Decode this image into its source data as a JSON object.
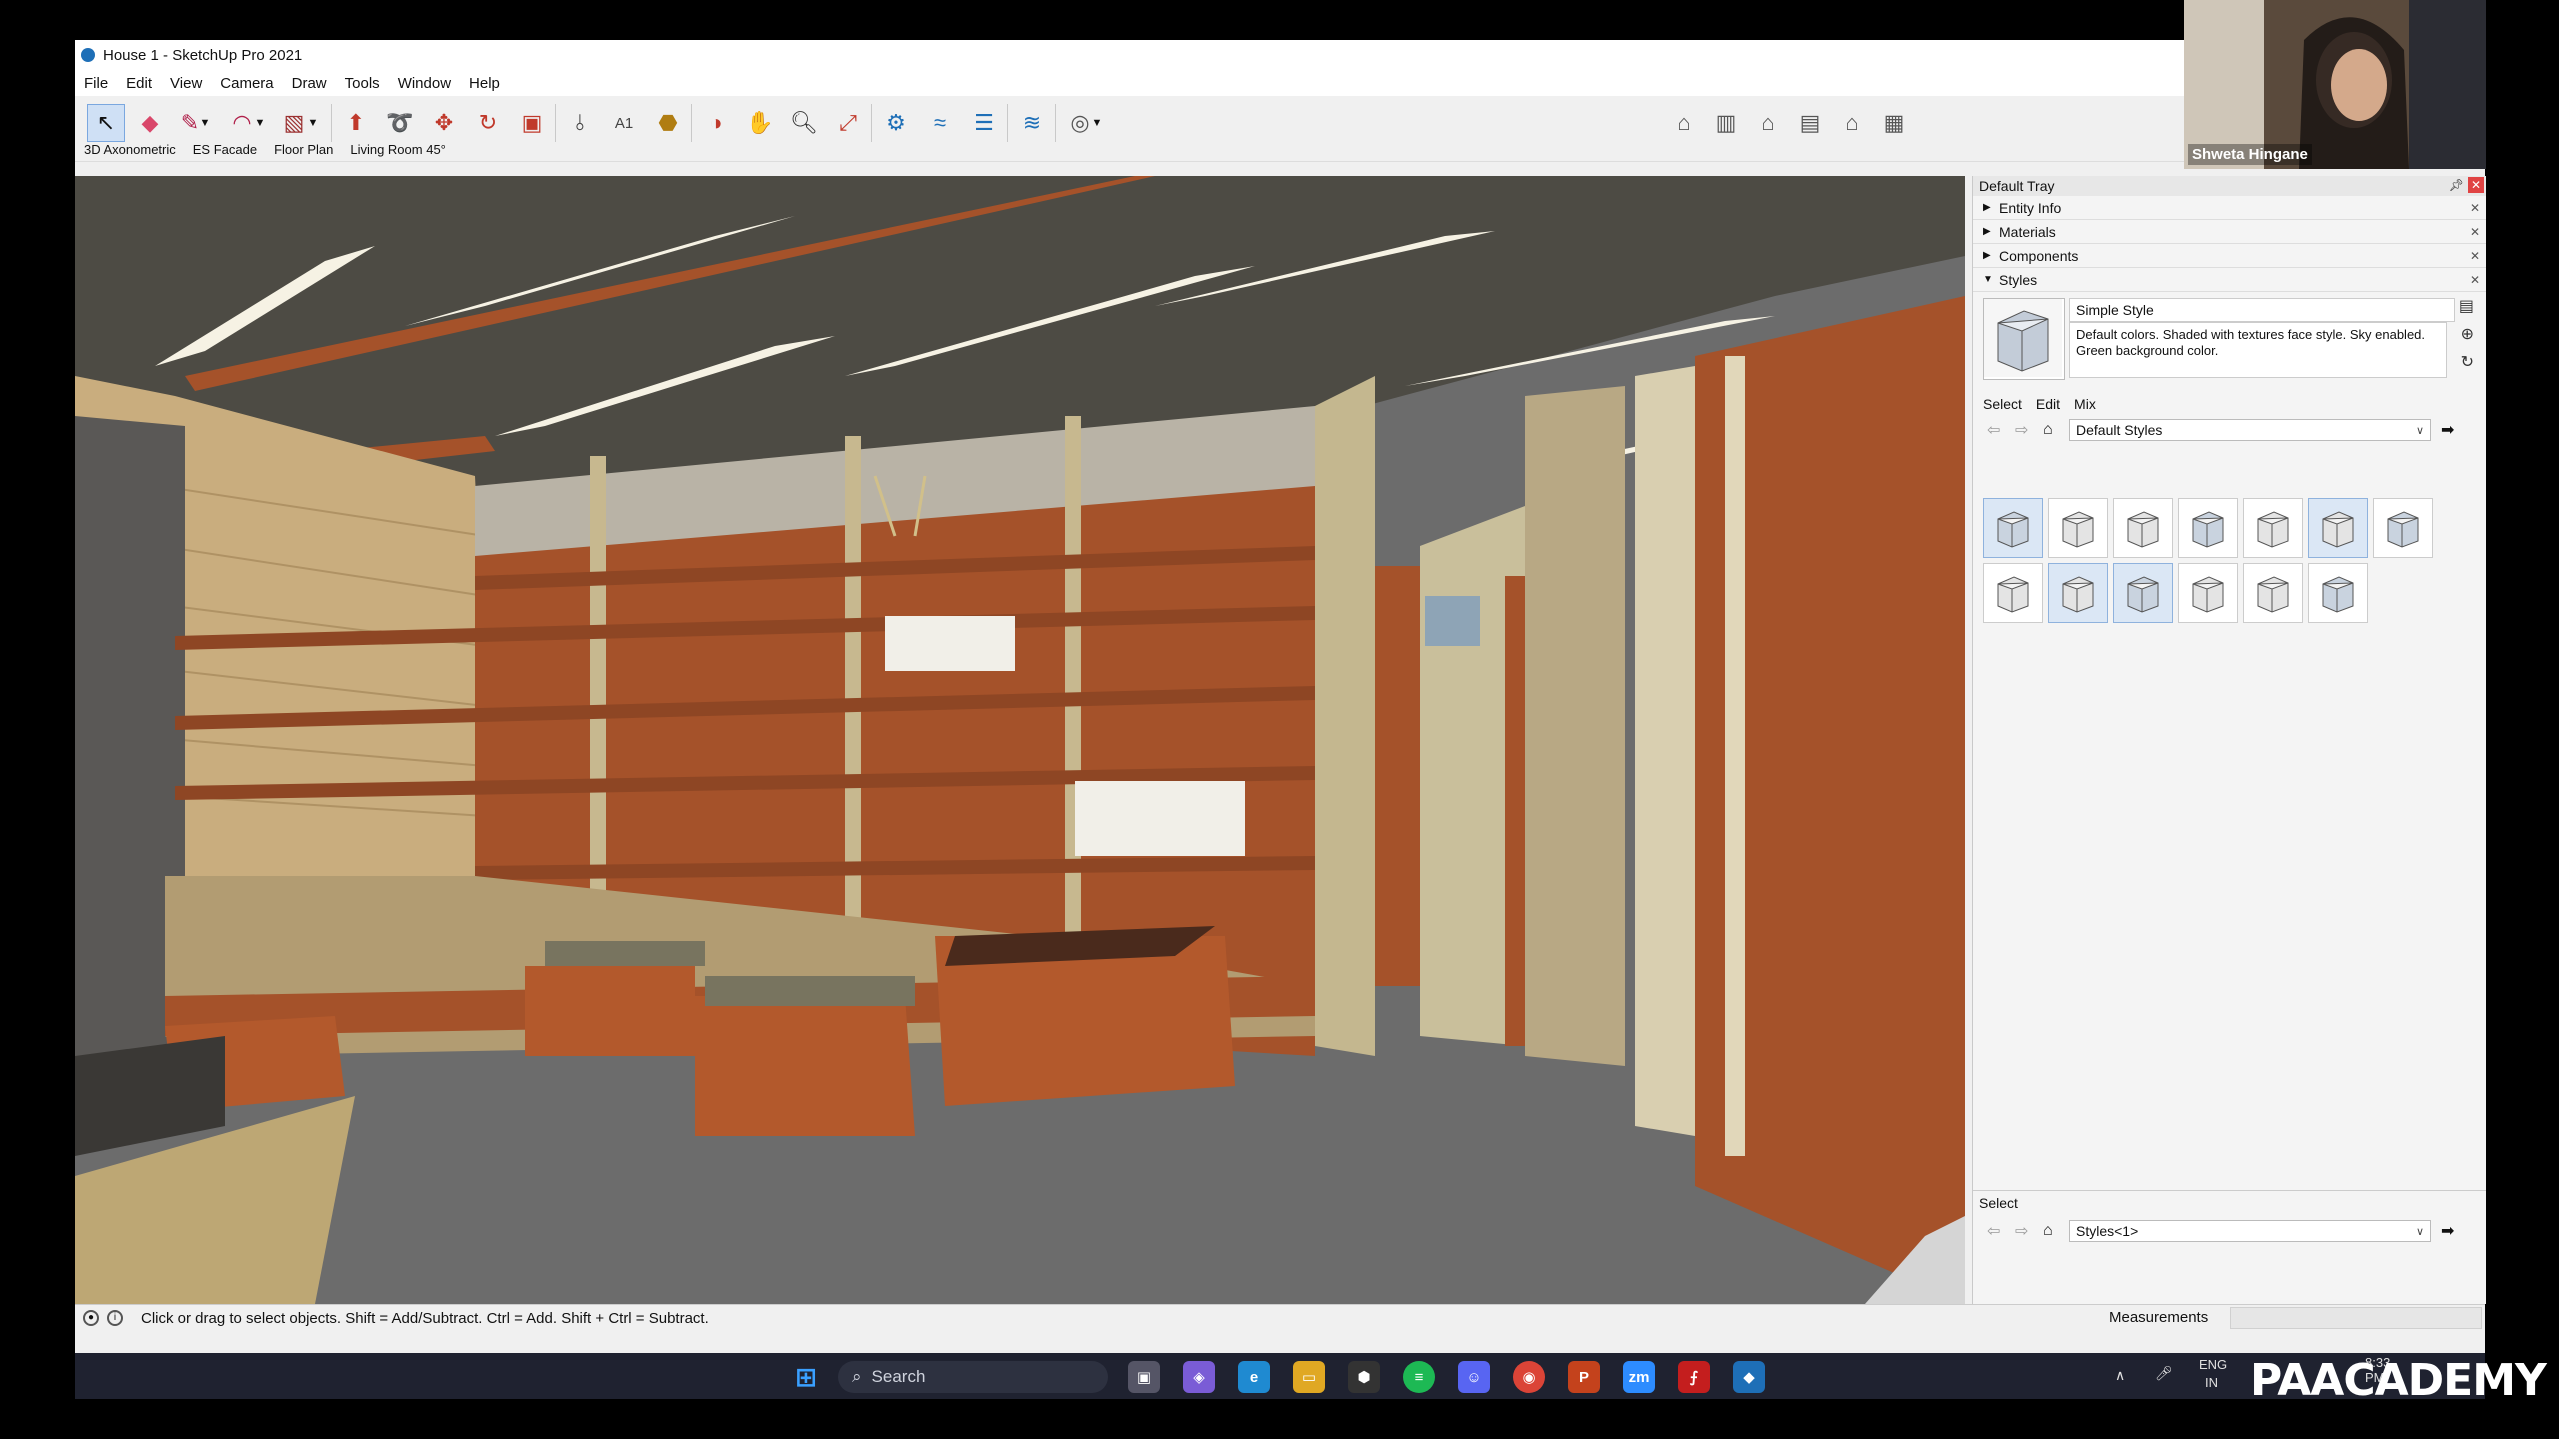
{
  "app": {
    "title": "House 1 - SketchUp Pro 2021",
    "menu": [
      "File",
      "Edit",
      "View",
      "Camera",
      "Draw",
      "Tools",
      "Window",
      "Help"
    ]
  },
  "toolbar": {
    "left_tools": [
      "select-icon",
      "eraser-icon",
      "pencil-icon",
      "arc-icon",
      "rectangle-icon",
      "push-pull-icon",
      "follow-me-icon",
      "move-icon",
      "rotate-icon",
      "scale-icon",
      "tape-measure-icon",
      "text-icon",
      "paint-bucket-icon",
      "orbit-icon",
      "pan-icon",
      "zoom-icon",
      "zoom-extents-icon",
      "warehouse-icon",
      "extension-icon",
      "layers-icon",
      "sandbox-icon",
      "account-icon"
    ],
    "view_tools": [
      "iso-view-icon",
      "top-view-icon",
      "front-view-icon",
      "right-view-icon",
      "back-view-icon",
      "left-view-icon"
    ]
  },
  "scenes": [
    "3D Axonometric",
    "ES Facade",
    "Floor Plan",
    "Living Room 45°"
  ],
  "tray": {
    "title": "Default Tray",
    "panels": [
      {
        "label": "Entity Info",
        "expanded": false
      },
      {
        "label": "Materials",
        "expanded": false
      },
      {
        "label": "Components",
        "expanded": false
      },
      {
        "label": "Styles",
        "expanded": true
      }
    ],
    "style_name": "Simple Style",
    "style_description": "Default colors.  Shaded with textures face style.  Sky enabled.  Green background color.",
    "tabs": [
      "Select",
      "Edit",
      "Mix"
    ],
    "collection": "Default Styles",
    "swatch_count": 13,
    "lower_title": "Select",
    "lower_collection": "Styles<1>"
  },
  "status": {
    "message": "Click or drag to select objects. Shift = Add/Subtract. Ctrl = Add. Shift + Ctrl = Subtract.",
    "measurements_label": "Measurements",
    "measurements_value": ""
  },
  "taskbar": {
    "search_placeholder": "Search",
    "language": "ENG",
    "region": "IN",
    "time": "8:33 PM",
    "apps": [
      "windows-start-icon",
      "task-view-icon",
      "copilot-icon",
      "edge-icon",
      "file-explorer-icon",
      "app-icon",
      "spotify-icon",
      "discord-icon",
      "chrome-icon",
      "powerpoint-icon",
      "zoom-icon",
      "acrobat-icon",
      "sketchup-icon"
    ]
  },
  "webcam": {
    "participant": "Shweta Hingane"
  },
  "watermark": "PAACADEMY",
  "colors": {
    "wood": "#a5522a",
    "ceiling": "#4d4b44",
    "floor": "#6c6c6c",
    "stone": "#c9ad7e",
    "accent": "#1e6fb7"
  }
}
